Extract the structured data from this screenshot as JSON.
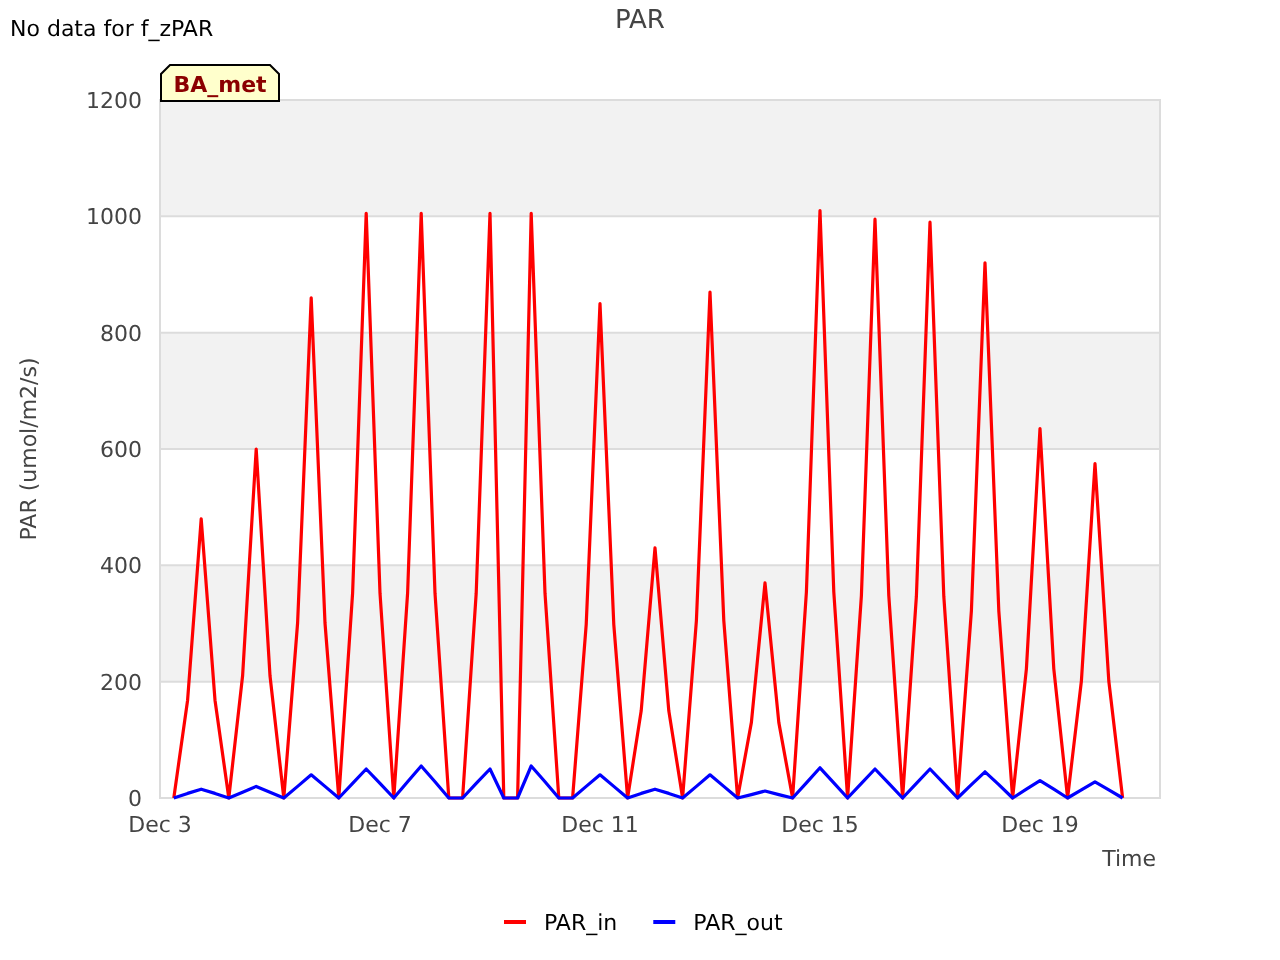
{
  "note": "No data for f_zPAR",
  "chart": {
    "tag": "BA_met",
    "chart_data": {
      "type": "line",
      "title": "PAR",
      "xlabel": "Time",
      "ylabel": "PAR (umol/m2/s)",
      "categories": [
        "Dec 3",
        null,
        null,
        null,
        null,
        null,
        null,
        null,
        null,
        null,
        null,
        null,
        null,
        null,
        null,
        null,
        "Dec 7",
        null,
        null,
        null,
        null,
        null,
        null,
        null,
        null,
        null,
        null,
        null,
        null,
        null,
        null,
        null,
        "Dec 11",
        null,
        null,
        null,
        null,
        null,
        null,
        null,
        null,
        null,
        null,
        null,
        null,
        null,
        null,
        null,
        "Dec 15",
        null,
        null,
        null,
        null,
        null,
        null,
        null,
        null,
        null,
        null,
        null,
        null,
        null,
        null,
        null,
        "Dec 19",
        null,
        null,
        null,
        null,
        null,
        null,
        null,
        null
      ],
      "series": [
        {
          "name": "PAR_in",
          "color": "#ff0000",
          "values": [
            null,
            0,
            168,
            480,
            168,
            0,
            210,
            600,
            210,
            0,
            301,
            860,
            301,
            0,
            352,
            1005,
            352,
            0,
            352,
            1005,
            352,
            0,
            0,
            352,
            1005,
            0,
            0,
            1005,
            352,
            0,
            0,
            298,
            850,
            298,
            0,
            150,
            430,
            150,
            0,
            305,
            870,
            305,
            0,
            130,
            370,
            130,
            0,
            354,
            1010,
            354,
            0,
            348,
            995,
            348,
            0,
            347,
            990,
            347,
            0,
            322,
            920,
            322,
            0,
            222,
            635,
            222,
            0,
            201,
            575,
            201,
            0,
            null,
            null
          ]
        },
        {
          "name": "PAR_out",
          "color": "#0000ff",
          "values": [
            null,
            0,
            8,
            15,
            8,
            0,
            10,
            20,
            10,
            0,
            20,
            40,
            20,
            0,
            25,
            50,
            25,
            0,
            28,
            55,
            28,
            0,
            0,
            25,
            50,
            0,
            0,
            55,
            28,
            0,
            0,
            20,
            40,
            20,
            0,
            8,
            15,
            8,
            0,
            20,
            40,
            20,
            0,
            6,
            12,
            6,
            0,
            26,
            52,
            26,
            0,
            25,
            50,
            25,
            0,
            25,
            50,
            25,
            0,
            23,
            45,
            23,
            0,
            15,
            30,
            15,
            0,
            14,
            28,
            14,
            0,
            null,
            null
          ]
        }
      ],
      "grid": true,
      "legend": true,
      "ylim": [
        0,
        1200
      ],
      "yticks": [
        0,
        200,
        400,
        600,
        800,
        1000,
        1200
      ]
    }
  }
}
